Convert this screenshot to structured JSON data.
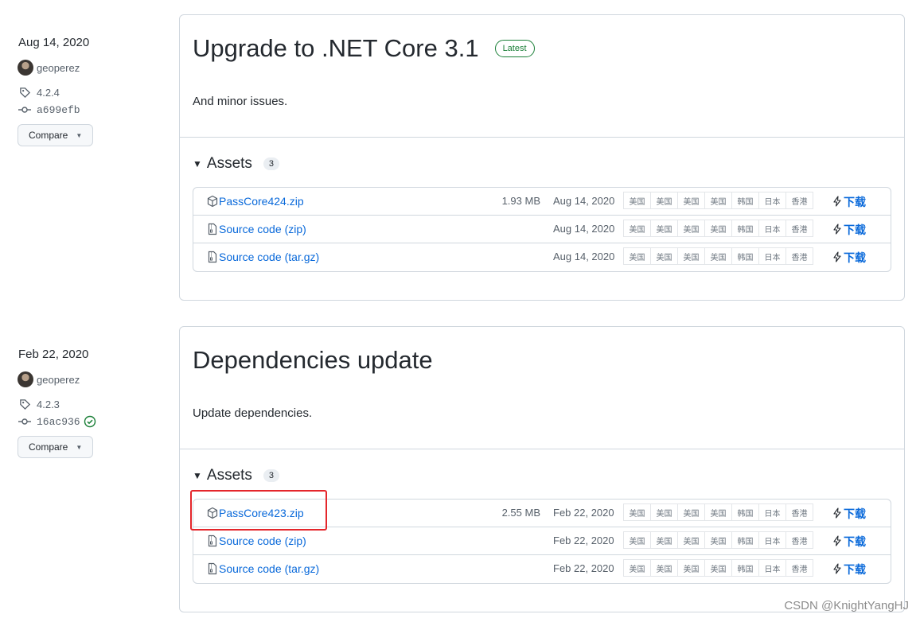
{
  "releases": [
    {
      "date": "Aug 14, 2020",
      "author": "geoperez",
      "tag": "4.2.4",
      "commit": "a699efb",
      "verified": false,
      "compare_label": "Compare",
      "title": "Upgrade to .NET Core 3.1",
      "latest_badge": "Latest",
      "body": "And minor issues.",
      "assets_label": "Assets",
      "assets_count": "3",
      "assets": [
        {
          "name": "PassCore424.zip",
          "suffix": "",
          "size": "1.93 MB",
          "date": "Aug 14, 2020",
          "type": "package"
        },
        {
          "name": "Source code",
          "suffix": "(zip)",
          "size": "",
          "date": "Aug 14, 2020",
          "type": "file-zip"
        },
        {
          "name": "Source code",
          "suffix": "(tar.gz)",
          "size": "",
          "date": "Aug 14, 2020",
          "type": "file-zip"
        }
      ]
    },
    {
      "date": "Feb 22, 2020",
      "author": "geoperez",
      "tag": "4.2.3",
      "commit": "16ac936",
      "verified": true,
      "compare_label": "Compare",
      "title": "Dependencies update",
      "latest_badge": "",
      "body": "Update dependencies.",
      "assets_label": "Assets",
      "assets_count": "3",
      "assets": [
        {
          "name": "PassCore423.zip",
          "suffix": "",
          "size": "2.55 MB",
          "date": "Feb 22, 2020",
          "type": "package"
        },
        {
          "name": "Source code",
          "suffix": "(zip)",
          "size": "",
          "date": "Feb 22, 2020",
          "type": "file-zip"
        },
        {
          "name": "Source code",
          "suffix": "(tar.gz)",
          "size": "",
          "date": "Feb 22, 2020",
          "type": "file-zip"
        }
      ]
    }
  ],
  "mirrors": [
    "美国",
    "美国",
    "美国",
    "美国",
    "韩国",
    "日本",
    "香港"
  ],
  "download_label": "下载",
  "watermark": "CSDN @KnightYangHJ",
  "colors": {
    "link": "#0969da",
    "latest": "#1a7f37",
    "highlight": "#e4262b",
    "border": "#d0d7de"
  }
}
